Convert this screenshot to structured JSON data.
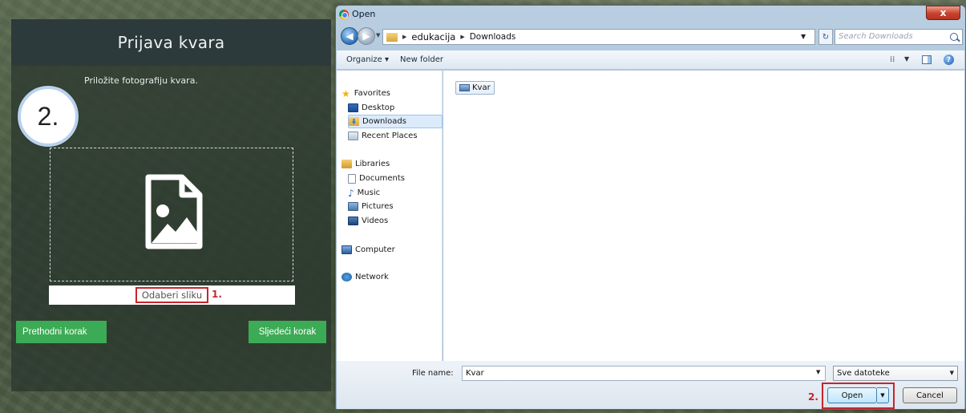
{
  "app": {
    "title": "Prijava kvara",
    "step_number": "2.",
    "step_instruction": "Priložite fotografiju kvara.",
    "choose_image_label": "Odaberi sliku",
    "annotation_1": "1.",
    "prev_button": "Prethodni korak",
    "next_button": "Sljedeći korak",
    "accent_color": "#3cab55",
    "annotation_color": "#c5262d"
  },
  "dialog": {
    "title": "Open",
    "close_glyph": "x",
    "address": {
      "crumbs": [
        "edukacija",
        "Downloads"
      ]
    },
    "search_placeholder": "Search Downloads",
    "toolbar": {
      "organize": "Organize ▾",
      "new_folder": "New folder"
    },
    "nav": {
      "favorites": "Favorites",
      "desktop": "Desktop",
      "downloads": "Downloads",
      "recent_places": "Recent Places",
      "libraries": "Libraries",
      "documents": "Documents",
      "music": "Music",
      "pictures": "Pictures",
      "videos": "Videos",
      "computer": "Computer",
      "network": "Network"
    },
    "files": [
      {
        "name": "Kvar",
        "icon": "picture-file-icon"
      }
    ],
    "file_name_label": "File name:",
    "file_name_value": "Kvar",
    "file_type_filter": "Sve datoteke",
    "annotation_2": "2.",
    "open_button": "Open",
    "cancel_button": "Cancel"
  }
}
